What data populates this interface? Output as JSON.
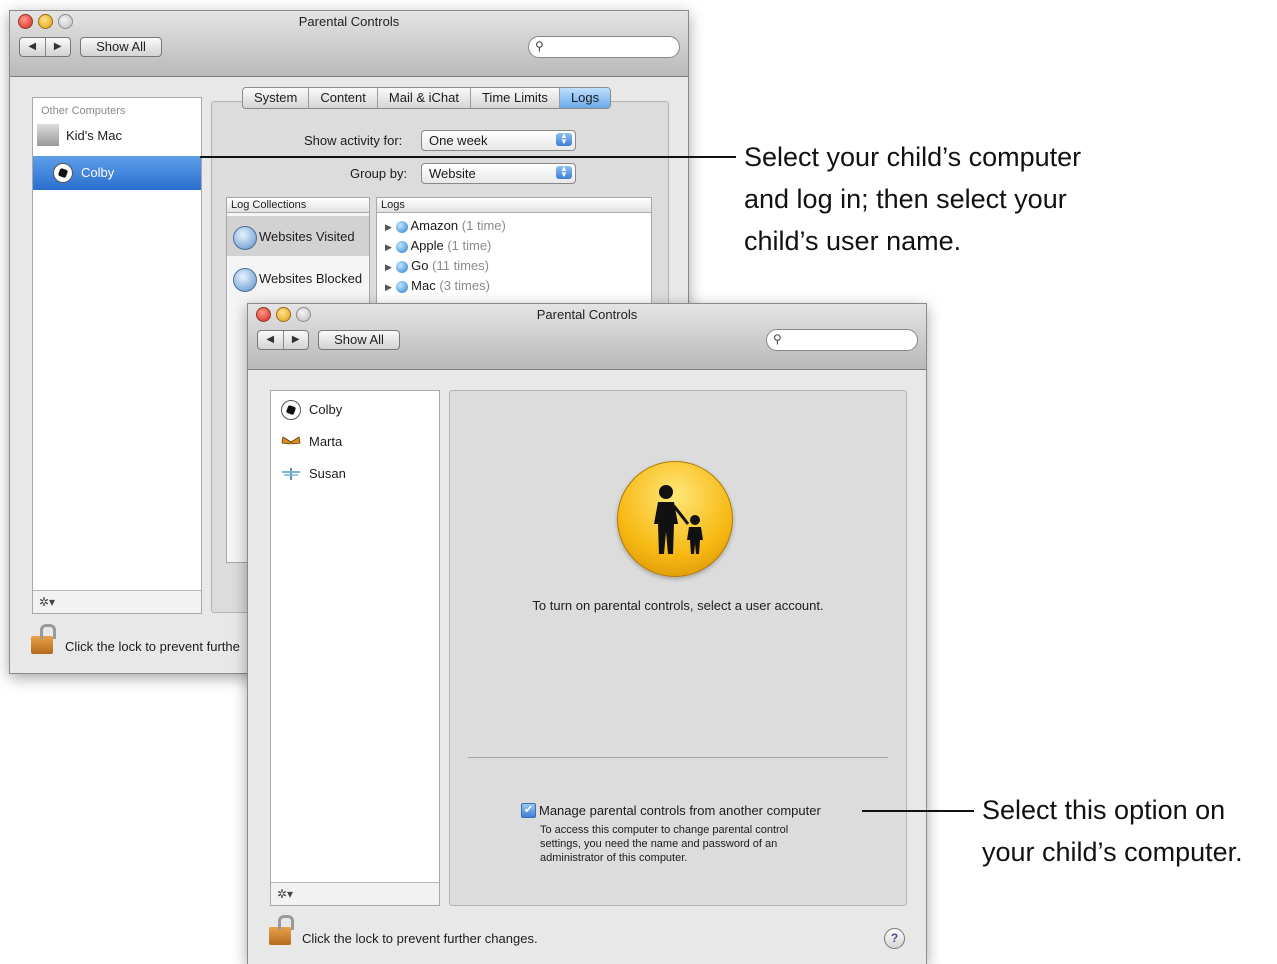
{
  "window_back": {
    "title": "Parental Controls",
    "show_all": "Show All",
    "nav_back": "◀",
    "nav_forward": "▶",
    "sidebar_header": "Other Computers",
    "computers": [
      {
        "label": "Kid's Mac"
      },
      {
        "label": "Colby",
        "selected": true
      }
    ],
    "tabs": [
      {
        "label": "System"
      },
      {
        "label": "Content"
      },
      {
        "label": "Mail & iChat"
      },
      {
        "label": "Time Limits"
      },
      {
        "label": "Logs",
        "selected": true
      }
    ],
    "show_activity_label": "Show activity for:",
    "show_activity_value": "One week",
    "group_by_label": "Group by:",
    "group_by_value": "Website",
    "log_collections_header": "Log Collections",
    "logs_header": "Logs",
    "log_collections": [
      "Websites Visited",
      "Websites Blocked"
    ],
    "logs": [
      {
        "site": "Amazon",
        "count": "(1 time)"
      },
      {
        "site": "Apple",
        "count": "(1 time)"
      },
      {
        "site": "Go",
        "count": "(11 times)"
      },
      {
        "site": "Mac",
        "count": "(3 times)"
      }
    ],
    "lock_text": "Click the lock to prevent furthe"
  },
  "window_front": {
    "title": "Parental Controls",
    "show_all": "Show All",
    "nav_back": "◀",
    "nav_forward": "▶",
    "users": [
      {
        "label": "Colby",
        "icon": "soccer-ball-icon"
      },
      {
        "label": "Marta",
        "icon": "butterfly-icon"
      },
      {
        "label": "Susan",
        "icon": "dragonfly-icon"
      }
    ],
    "message": "To turn on parental controls, select a user account.",
    "manage_checkbox_label": "Manage parental controls from another computer",
    "manage_checked": true,
    "manage_help_lines": [
      "To access this computer to change parental control",
      "settings, you need the name and password of an",
      "administrator of this computer."
    ],
    "lock_text": "Click the lock to prevent further changes.",
    "help": "?"
  },
  "callouts": {
    "top_lines": [
      "Select your child’s computer",
      "and log in; then select your",
      "child’s user name."
    ],
    "bottom_lines": [
      "Select this option on",
      "your child’s computer."
    ]
  }
}
